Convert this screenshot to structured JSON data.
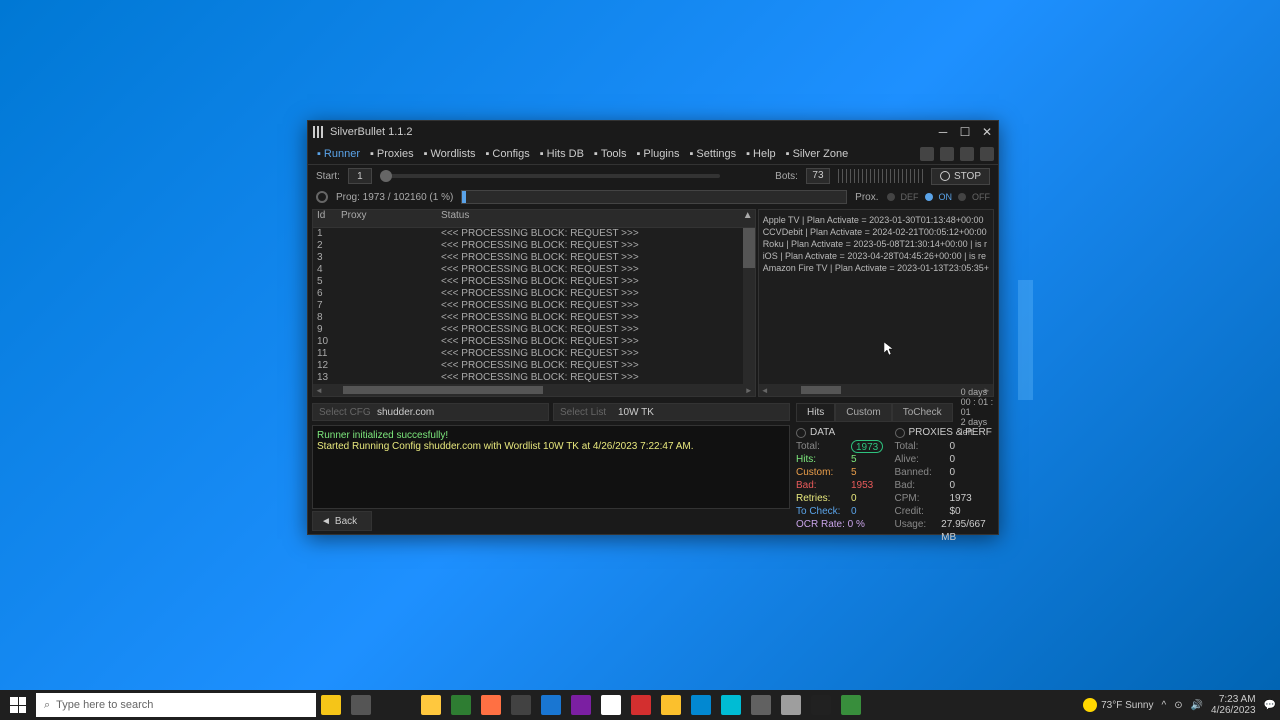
{
  "window": {
    "title": "SilverBullet 1.1.2"
  },
  "toolbar": {
    "items": [
      {
        "label": "Runner",
        "active": true
      },
      {
        "label": "Proxies"
      },
      {
        "label": "Wordlists"
      },
      {
        "label": "Configs"
      },
      {
        "label": "Hits DB"
      },
      {
        "label": "Tools"
      },
      {
        "label": "Plugins"
      },
      {
        "label": "Settings"
      },
      {
        "label": "Help"
      },
      {
        "label": "Silver Zone"
      }
    ]
  },
  "config": {
    "start_label": "Start:",
    "start_value": "1",
    "bots_label": "Bots:",
    "bots_value": "73",
    "stop_label": "STOP"
  },
  "progress": {
    "label": "Prog: 1973 / 102160 (1 %)",
    "prox_label": "Prox.",
    "def": "DEF",
    "on": "ON",
    "off": "OFF"
  },
  "table": {
    "headers": {
      "id": "Id",
      "proxy": "Proxy",
      "status": "Status"
    },
    "rows": [
      {
        "id": "1",
        "status": "<<< PROCESSING BLOCK: REQUEST >>>"
      },
      {
        "id": "2",
        "status": "<<< PROCESSING BLOCK: REQUEST >>>"
      },
      {
        "id": "3",
        "status": "<<< PROCESSING BLOCK: REQUEST >>>"
      },
      {
        "id": "4",
        "status": "<<< PROCESSING BLOCK: REQUEST >>>"
      },
      {
        "id": "5",
        "status": "<<< PROCESSING BLOCK: REQUEST >>>"
      },
      {
        "id": "6",
        "status": "<<< PROCESSING BLOCK: REQUEST >>>"
      },
      {
        "id": "7",
        "status": "<<< PROCESSING BLOCK: REQUEST >>>"
      },
      {
        "id": "8",
        "status": "<<< PROCESSING BLOCK: REQUEST >>>"
      },
      {
        "id": "9",
        "status": "<<< PROCESSING BLOCK: REQUEST >>>"
      },
      {
        "id": "10",
        "status": "<<< PROCESSING BLOCK: REQUEST >>>"
      },
      {
        "id": "11",
        "status": "<<< PROCESSING BLOCK: REQUEST >>>"
      },
      {
        "id": "12",
        "status": "<<< PROCESSING BLOCK: REQUEST >>>"
      },
      {
        "id": "13",
        "status": "<<< PROCESSING BLOCK: REQUEST >>>"
      }
    ]
  },
  "log": {
    "lines": [
      "Apple TV | Plan Activate = 2023-01-30T01:13:48+00:00",
      "CCVDebit | Plan Activate = 2024-02-21T00:05:12+00:00",
      "Roku | Plan Activate = 2023-05-08T21:30:14+00:00 | is r",
      "iOS | Plan Activate = 2023-04-28T04:45:26+00:00 | is re",
      "Amazon Fire TV | Plan Activate = 2023-01-13T23:05:35+"
    ]
  },
  "selectors": {
    "cfg_label": "Select CFG",
    "cfg_value": "shudder.com",
    "list_label": "Select List",
    "list_value": "10W TK"
  },
  "console": {
    "line1": "Runner initialized succesfully!",
    "line2": "Started Running Config shudder.com with Wordlist 10W TK at 4/26/2023 7:22:47 AM."
  },
  "back_label": "Back",
  "tabs": {
    "hits": "Hits",
    "custom": "Custom",
    "tocheck": "ToCheck"
  },
  "timer": {
    "elapsed": "0  days  00 : 01 : 01",
    "remaining": "2 days left"
  },
  "data_stats": {
    "header": "DATA",
    "total_label": "Total:",
    "total_value": "1973",
    "hits_label": "Hits:",
    "hits_value": "5",
    "custom_label": "Custom:",
    "custom_value": "5",
    "bad_label": "Bad:",
    "bad_value": "1953",
    "retries_label": "Retries:",
    "retries_value": "0",
    "tocheck_label": "To Check:",
    "tocheck_value": "0",
    "ocr_label": "OCR Rate: 0 %"
  },
  "perf_stats": {
    "header": "PROXIES & PERF",
    "total_label": "Total:",
    "total_value": "0",
    "alive_label": "Alive:",
    "alive_value": "0",
    "banned_label": "Banned:",
    "banned_value": "0",
    "bad_label": "Bad:",
    "bad_value": "0",
    "cpm_label": "CPM:",
    "cpm_value": "1973",
    "credit_label": "Credit:",
    "credit_value": "$0",
    "usage_label": "Usage:",
    "usage_value": "27.95/667 MB"
  },
  "taskbar": {
    "search_placeholder": "Type here to search",
    "weather": "73°F  Sunny",
    "time": "7:23 AM",
    "date": "4/26/2023"
  }
}
